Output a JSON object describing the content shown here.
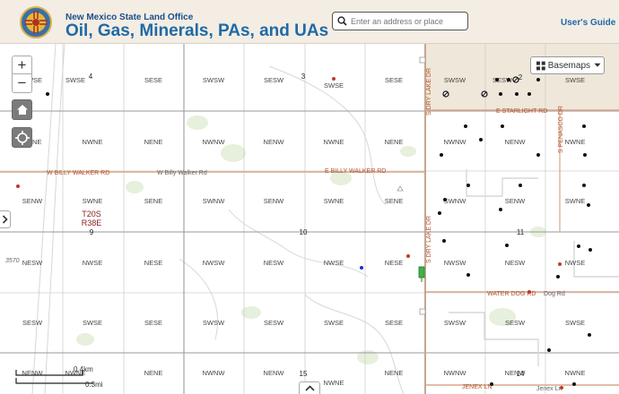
{
  "header": {
    "agency": "New Mexico State Land Office",
    "title": "Oil, Gas, Minerals, PAs, and UAs",
    "users_guide": "User's Guide"
  },
  "search": {
    "placeholder": "Enter an address or place"
  },
  "map_controls": {
    "zoom_in": "+",
    "zoom_out": "−",
    "basemaps_label": "Basemaps"
  },
  "scalebar": {
    "metric": "0.4km",
    "imperial": "0.3mi"
  },
  "sections": [
    "4",
    "3",
    "2",
    "10",
    "11",
    "15",
    "14",
    "9"
  ],
  "township": {
    "twp": "T20S",
    "rng": "R38E",
    "sec": "9"
  },
  "elevation": "3570",
  "roads": {
    "billy_walker_left": "W BILLY WALKER RD",
    "billy_walker_mid": "W Billy Walker Rd",
    "billy_walker_right": "E BILLY WALKER RD",
    "starlight": "E STARLIGHT RD",
    "penasco": "S PENASCO DR",
    "water_dog": "WATER DOG RD",
    "water_dog_alt": "Dog Rd",
    "jenex": "JENEX LN",
    "jenex_alt": "Jenex Ln",
    "dry_lake_upper": "S DRY LAKE DR",
    "dry_lake_lower": "S DRY LAKE DR"
  },
  "quarter_labels": {
    "row1": [
      "SWSE",
      "SESE",
      "SWSW",
      "SESW",
      "SWSE",
      "SESE",
      "SWSW",
      "SESW",
      "SWSE"
    ],
    "row2": [
      "NENE",
      "NWNE",
      "NENE",
      "NWNW",
      "NENW",
      "NWNE",
      "NENE",
      "NWNW",
      "NENW",
      "NWNE",
      "NENE"
    ],
    "row3": [
      "SENW",
      "SWNE",
      "SENE",
      "SWNW",
      "SENW",
      "SWNE",
      "SENE",
      "SWNW",
      "SENW",
      "SWNE"
    ],
    "row4": [
      "NESW",
      "NWSE",
      "NESE",
      "NWSW",
      "NESW",
      "NWSE",
      "NESE",
      "NWSW",
      "NESW",
      "NWSE"
    ],
    "row5": [
      "SESW",
      "SWSE",
      "SESE",
      "SWSW",
      "SESW",
      "SWSE",
      "SESE",
      "SWSW",
      "SESW",
      "SWSE"
    ],
    "row6": [
      "NENW",
      "NWNE",
      "NENE",
      "NWNW",
      "NENW",
      "NWNE",
      "NENE",
      "NWNW",
      "NENW",
      "NWNE"
    ]
  },
  "colors": {
    "header_bg": "#f3ede4",
    "title_blue": "#1f6aa6",
    "road_label": "#b0542e",
    "grid": "#a8a8a8",
    "well_dot": "#111111",
    "red_well": "#c0392b",
    "blue_well": "#1a2fd6",
    "shaded_land": "#efe7d9"
  }
}
